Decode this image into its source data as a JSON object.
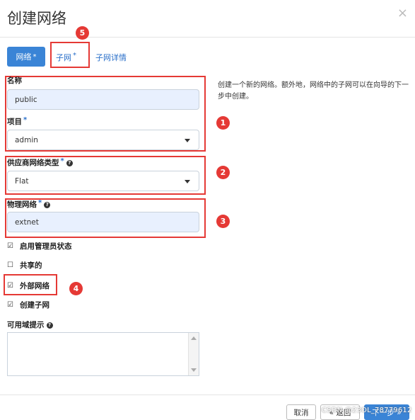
{
  "dialog": {
    "title": "创建网络",
    "close_symbol": "×"
  },
  "tabs": [
    {
      "label": "网络",
      "required": "*"
    },
    {
      "label": "子网",
      "required": "*"
    },
    {
      "label": "子网详情"
    }
  ],
  "form": {
    "name_label": "名称",
    "name_value": "public",
    "project_label": "项目",
    "project_required": "*",
    "project_value": "admin",
    "provider_type_label": "供应商网络类型",
    "provider_type_required": "*",
    "provider_type_value": "Flat",
    "physical_network_label": "物理网络",
    "physical_network_required": "*",
    "physical_network_value": "extnet",
    "admin_state_label": "启用管理员状态",
    "shared_label": "共享的",
    "external_label": "外部网络",
    "create_subnet_label": "创建子网",
    "az_hint_label": "可用域提示"
  },
  "checkboxes": {
    "admin_state": true,
    "shared": false,
    "external": true,
    "create_subnet": true,
    "checked_glyph": "☑",
    "unchecked_glyph": "☐"
  },
  "description": "创建一个新的网络。额外地，网络中的子网可以在向导的下一步中创建。",
  "annotations": [
    "1",
    "2",
    "3",
    "4",
    "5"
  ],
  "footer": {
    "cancel_label": "取消",
    "back_label": "« 返回",
    "next_label": "下一步 »"
  },
  "watermark": "CSDN @23OL_78779612",
  "colors": {
    "primary": "#3a84d6",
    "annotation_red": "#e53935",
    "link": "#2a6fc9"
  },
  "icons": {
    "help": "?",
    "caret": "dropdown-caret"
  }
}
